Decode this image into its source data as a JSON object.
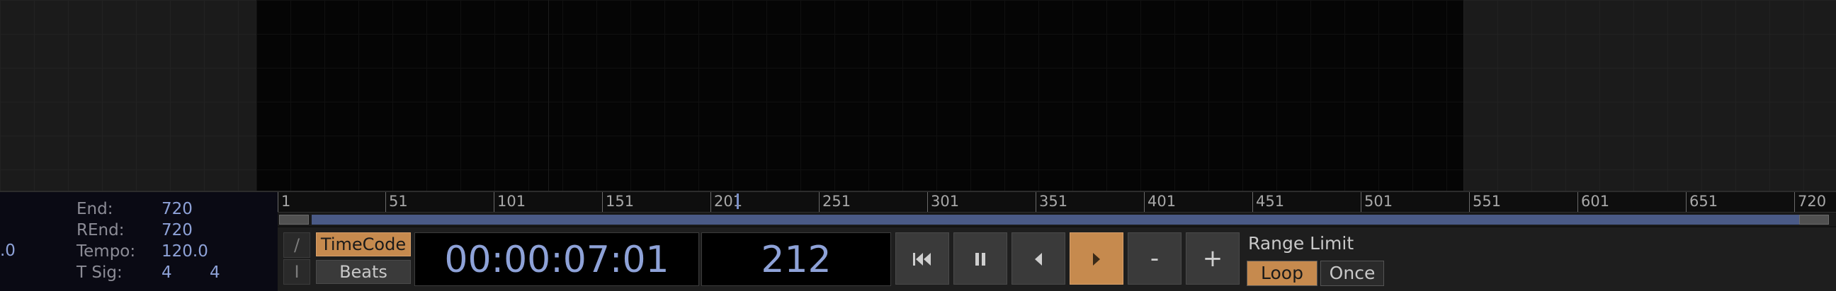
{
  "info": {
    "cutoff_value": ".0",
    "rows": [
      {
        "label": "End:",
        "value": "720"
      },
      {
        "label": "REnd:",
        "value": "720"
      },
      {
        "label": "Tempo:",
        "value": "120.0"
      }
    ],
    "tsig_label": "T Sig:",
    "tsig_num": "4",
    "tsig_den": "4"
  },
  "ruler": {
    "ticks": [
      "1",
      "51",
      "101",
      "151",
      "201",
      "251",
      "301",
      "351",
      "401",
      "451",
      "501",
      "551",
      "601",
      "651",
      "720"
    ]
  },
  "timeline": {
    "current_frame": 212
  },
  "controls": {
    "slash_glyph": "/",
    "ibeam_glyph": "I",
    "timecode_label": "TimeCode",
    "beats_label": "Beats",
    "timecode_display": "00:00:07:01",
    "frame_display": "212",
    "minus_label": "-",
    "plus_label": "+",
    "range_limit_label": "Range Limit",
    "loop_label": "Loop",
    "once_label": "Once"
  },
  "colors": {
    "accent": "#c68a4e",
    "value_blue": "#8ea2d8",
    "scroll_blue": "#4a5a86"
  },
  "icons": [
    "skip-to-start-icon",
    "pause-icon",
    "step-back-icon",
    "play-icon"
  ]
}
